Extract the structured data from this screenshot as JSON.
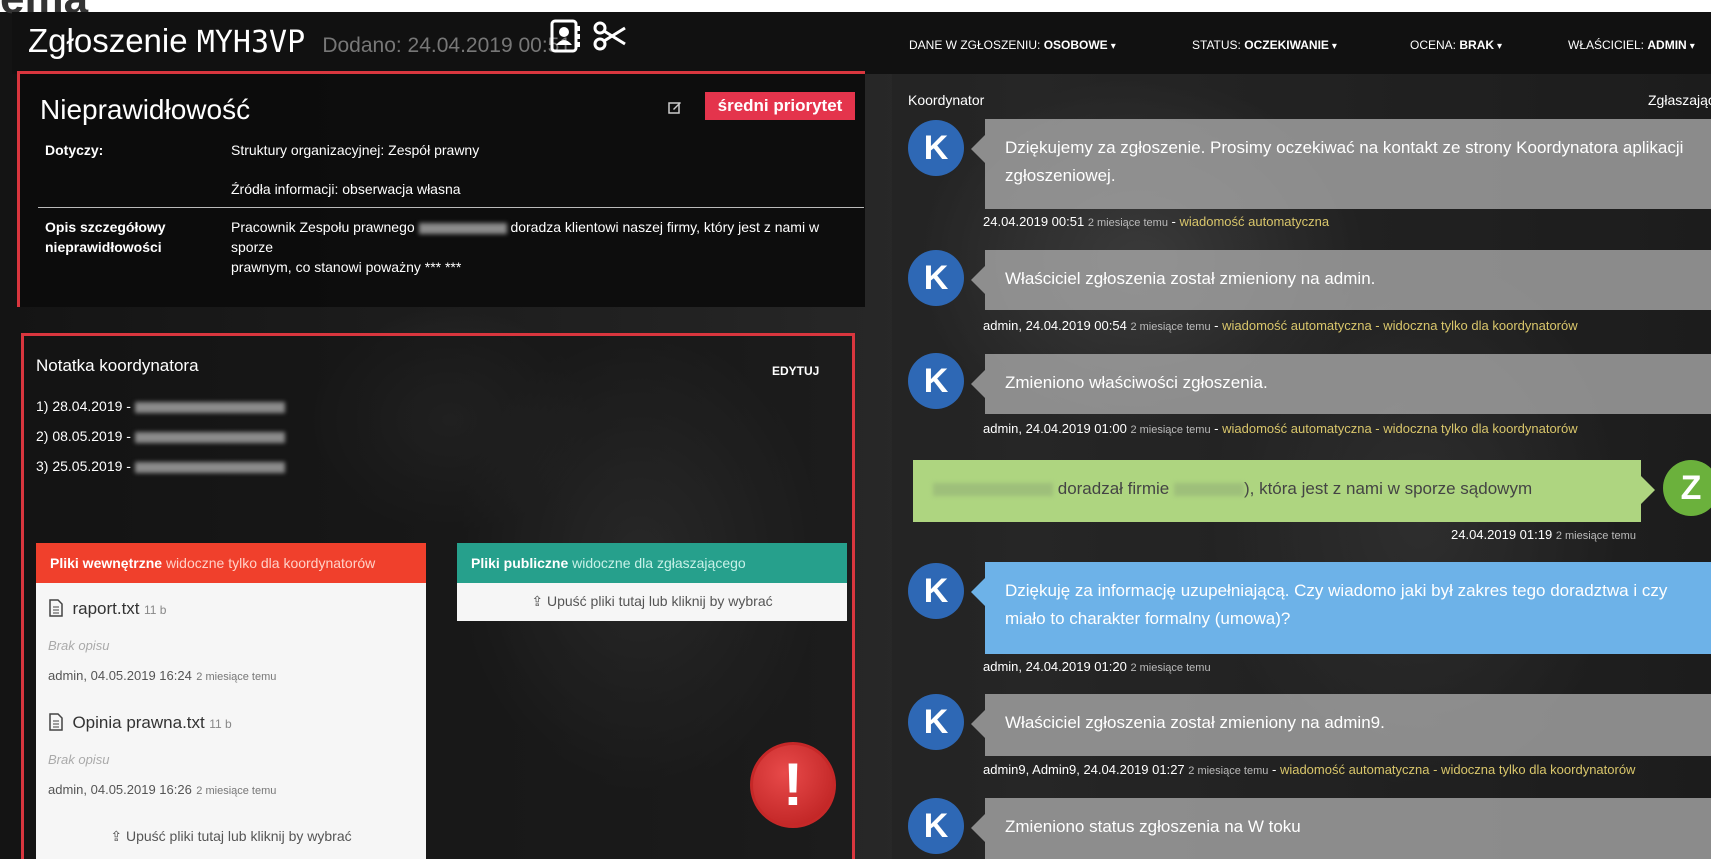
{
  "top_strip": "ema",
  "header": {
    "title": "Zgłoszenie",
    "code": "MYH3VP",
    "added": "Dodano: 24.04.2019 00:51",
    "menu": [
      {
        "label": "DANE W ZGŁOSZENIU:",
        "value": "OSOBOWE"
      },
      {
        "label": "STATUS:",
        "value": "OCZEKIWANIE"
      },
      {
        "label": "OCENA:",
        "value": "BRAK"
      },
      {
        "label": "WŁAŚCICIEL:",
        "value": "ADMIN"
      }
    ]
  },
  "report": {
    "title": "Nieprawidłowość",
    "priority": "średni priorytet",
    "concerns_label": "Dotyczy:",
    "concerns_1": "Struktury organizacyjnej:  Zespół prawny",
    "concerns_2": "Źródła informacji:  obserwacja własna",
    "desc_label": "Opis szczegółowy nieprawidłowości",
    "desc_1a": "Pracownik Zespołu prawnego",
    "desc_1b": "doradza klientowi naszej firmy, który jest z nami w sporze",
    "desc_2": "prawnym, co stanowi poważny *** ***"
  },
  "coordinator_note": {
    "title": "Notatka koordynatora",
    "edit": "EDYTUJ",
    "items": [
      "1) 28.04.2019 -",
      "2) 08.05.2019 -",
      "3) 25.05.2019 -"
    ]
  },
  "internal_files": {
    "head": "Pliki wewnętrzne",
    "head_note": "widoczne tylko dla koordynatorów",
    "color": "#f0402c",
    "files": [
      {
        "name": "raport.txt",
        "size": "11 b",
        "desc": "Brak opisu",
        "meta": "admin, 04.05.2019 16:24",
        "ago": "2 miesiące temu"
      },
      {
        "name": "Opinia prawna.txt",
        "size": "11 b",
        "desc": "Brak opisu",
        "meta": "admin, 04.05.2019 16:26",
        "ago": "2 miesiące temu"
      }
    ],
    "dropzone": "Upuść pliki tutaj lub kliknij by wybrać"
  },
  "public_files": {
    "head": "Pliki publiczne",
    "head_note": "widoczne dla zgłaszającego",
    "color": "#26a08c",
    "dropzone": "Upuść pliki tutaj lub kliknij by wybrać"
  },
  "chat": {
    "left_label": "Koordynator",
    "right_label": "Zgłaszający",
    "messages": [
      {
        "avatar": "K",
        "text": "Dziękujemy za zgłoszenie. Prosimy oczekiwać na kontakt ze strony Koordynatora aplikacji zgłoszeniowej.",
        "meta": "24.04.2019 00:51",
        "ago": "2 miesiące temu",
        "auto": "wiadomość automatyczna"
      },
      {
        "avatar": "K",
        "text": "Właściciel zgłoszenia został zmieniony na admin.",
        "meta": "admin, 24.04.2019 00:54",
        "ago": "2 miesiące temu",
        "auto": "wiadomość automatyczna - widoczna tylko dla koordynatorów"
      },
      {
        "avatar": "K",
        "text": "Zmieniono właściwości zgłoszenia.",
        "meta": "admin, 24.04.2019 01:00",
        "ago": "2 miesiące temu",
        "auto": "wiadomość automatyczna - widoczna tylko dla koordynatorów"
      },
      {
        "avatar": "Z",
        "text_a": "doradzał firmie",
        "text_b": "), która jest z nami w sporze sądowym",
        "meta": "24.04.2019 01:19",
        "ago": "2 miesiące temu"
      },
      {
        "avatar": "K",
        "text": "Dziękuję za informację uzupełniającą. Czy wiadomo jaki był zakres tego doradztwa i czy miało to charakter formalny (umowa)?",
        "meta": "admin, 24.04.2019 01:20",
        "ago": "2 miesiące temu"
      },
      {
        "avatar": "K",
        "text": "Właściciel zgłoszenia został zmieniony na admin9.",
        "meta": "admin9, Admin9, 24.04.2019 01:27",
        "ago": "2 miesiące temu",
        "auto": "wiadomość automatyczna - widoczna tylko dla koordynatorów"
      },
      {
        "avatar": "K",
        "text": "Zmieniono status zgłoszenia na W toku"
      }
    ]
  },
  "colors": {
    "priority": "#e4344c",
    "accent_red": "#d9363e",
    "avatar_k": "#2e68b5",
    "avatar_z": "#6bb13c"
  }
}
